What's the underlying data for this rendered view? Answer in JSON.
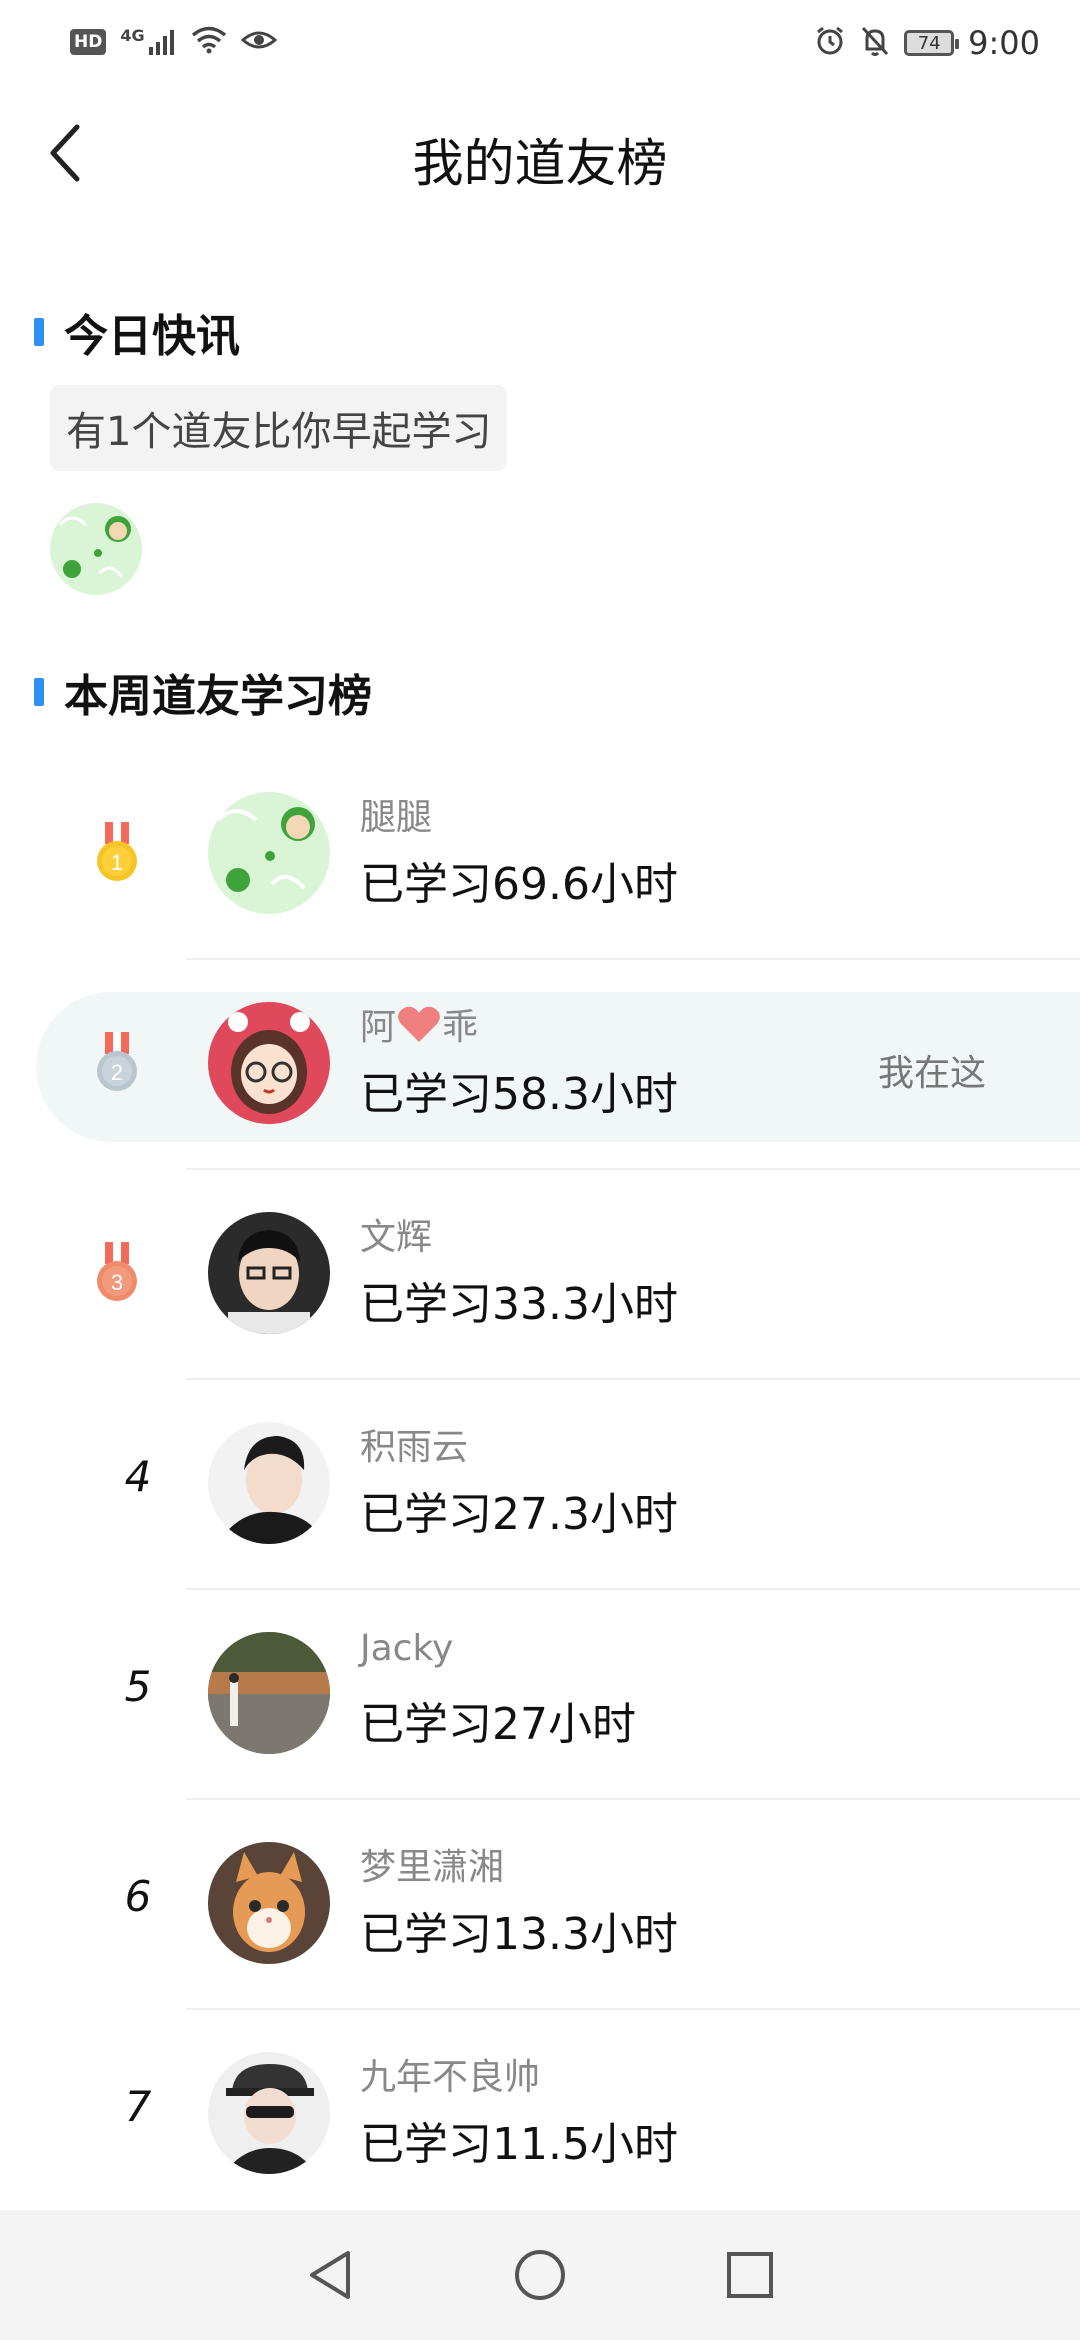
{
  "status_bar": {
    "hd": "HD",
    "network": "4G",
    "battery": "74",
    "time": "9:00"
  },
  "header": {
    "title": "我的道友榜"
  },
  "news": {
    "section_title": "今日快讯",
    "message": "有1个道友比你早起学习"
  },
  "ranking": {
    "section_title": "本周道友学习榜",
    "me_label": "我在这",
    "rows": [
      {
        "rank": "1",
        "name": "腿腿",
        "time": "已学习69.6小时"
      },
      {
        "rank": "2",
        "name_prefix": "阿",
        "name_suffix": "乖",
        "time": "已学习58.3小时"
      },
      {
        "rank": "3",
        "name": "文辉",
        "time": "已学习33.3小时"
      },
      {
        "rank": "4",
        "name": "积雨云",
        "time": "已学习27.3小时"
      },
      {
        "rank": "5",
        "name": "Jacky",
        "time": "已学习27小时"
      },
      {
        "rank": "6",
        "name": "梦里潇湘",
        "time": "已学习13.3小时"
      },
      {
        "rank": "7",
        "name": "九年不良帅",
        "time": "已学习11.5小时"
      }
    ]
  },
  "colors": {
    "accent": "#2f8ff5",
    "highlight": "#f1f6f6",
    "gold": "#f7c325",
    "silver": "#b9c5cf",
    "bronze": "#ef8a6a"
  },
  "icons": {
    "back": "chevron-left-icon",
    "nav_back": "triangle-back-icon",
    "nav_home": "circle-home-icon",
    "nav_recent": "square-recent-icon"
  }
}
